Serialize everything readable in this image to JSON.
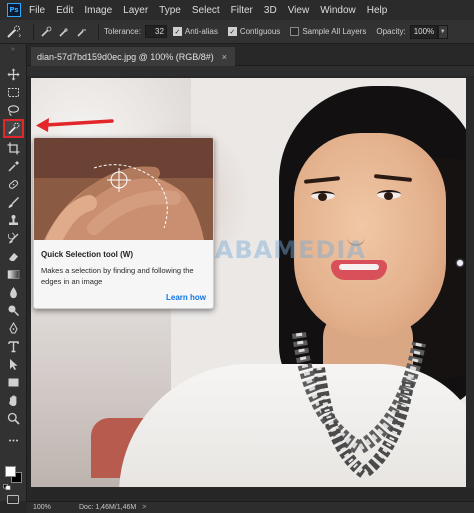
{
  "app": {
    "logo_text": "Ps"
  },
  "menu": {
    "items": [
      "File",
      "Edit",
      "Image",
      "Layer",
      "Type",
      "Select",
      "Filter",
      "3D",
      "View",
      "Window",
      "Help"
    ]
  },
  "options_bar": {
    "tolerance_label": "Tolerance:",
    "tolerance_value": "32",
    "anti_alias_label": "Anti-alias",
    "anti_alias_checked": true,
    "contiguous_label": "Contiguous",
    "contiguous_checked": true,
    "sample_all_label": "Sample All Layers",
    "sample_all_checked": false,
    "opacity_label": "Opacity:",
    "opacity_value": "100%"
  },
  "document": {
    "tab_title": "dian-57d7bd159d0ec.jpg @ 100% (RGB/8#)",
    "close_glyph": "×"
  },
  "canvas": {
    "watermark": "NESABAMEDIA"
  },
  "tooltip": {
    "title": "Quick Selection tool (W)",
    "description": "Makes a selection by finding and following the edges in an image",
    "link": "Learn how"
  },
  "tools": {
    "selected": "quick-selection-tool",
    "icons": [
      "move-icon",
      "marquee-icon",
      "lasso-icon",
      "quick-selection-icon",
      "crop-icon",
      "eyedropper-icon",
      "healing-brush-icon",
      "brush-icon",
      "clone-stamp-icon",
      "history-brush-icon",
      "eraser-icon",
      "gradient-icon",
      "blur-icon",
      "dodge-icon",
      "pen-icon",
      "type-icon",
      "path-selection-icon",
      "rectangle-icon",
      "hand-icon",
      "zoom-icon"
    ]
  },
  "colors": {
    "foreground": "#ffffff",
    "background": "#000000",
    "highlight_red": "#e3262a",
    "link_blue": "#1473e6"
  },
  "status_bar": {
    "zoom": "100%",
    "doc_info": "Doc: 1,46M/1,46M",
    "arrow_glyph": ">"
  }
}
